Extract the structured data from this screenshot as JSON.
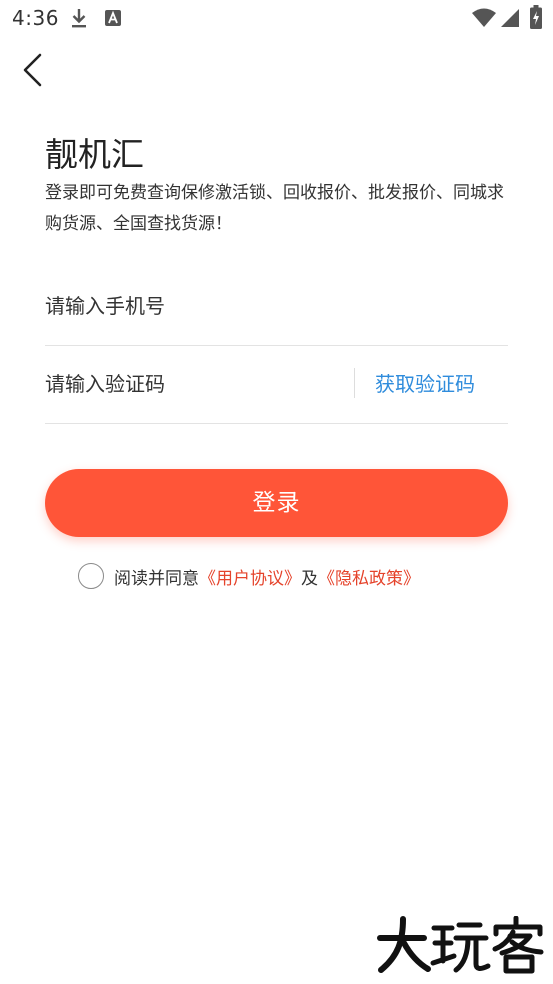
{
  "status_bar": {
    "time": "4:36",
    "icons": [
      "download-icon",
      "font-a-icon",
      "wifi-icon",
      "signal-icon",
      "battery-charging-icon"
    ]
  },
  "nav": {
    "back_icon": "chevron-left-icon"
  },
  "header": {
    "title": "靓机汇",
    "description": "登录即可免费查询保修激活锁、回收报价、批发报价、同城求购货源、全国查找货源！"
  },
  "form": {
    "phone_placeholder": "请输入手机号",
    "phone_value": "",
    "code_placeholder": "请输入验证码",
    "code_value": "",
    "get_code_label": "获取验证码",
    "login_label": "登录"
  },
  "agreement": {
    "checked": false,
    "prefix": "阅读并同意",
    "user_agreement": "《用户协议》",
    "connector": "及",
    "privacy_policy": "《隐私政策》"
  },
  "watermark": {
    "text": "大玩客"
  },
  "colors": {
    "accent": "#ff5538",
    "link_red": "#e5432b",
    "link_blue": "#2f8cdc"
  }
}
